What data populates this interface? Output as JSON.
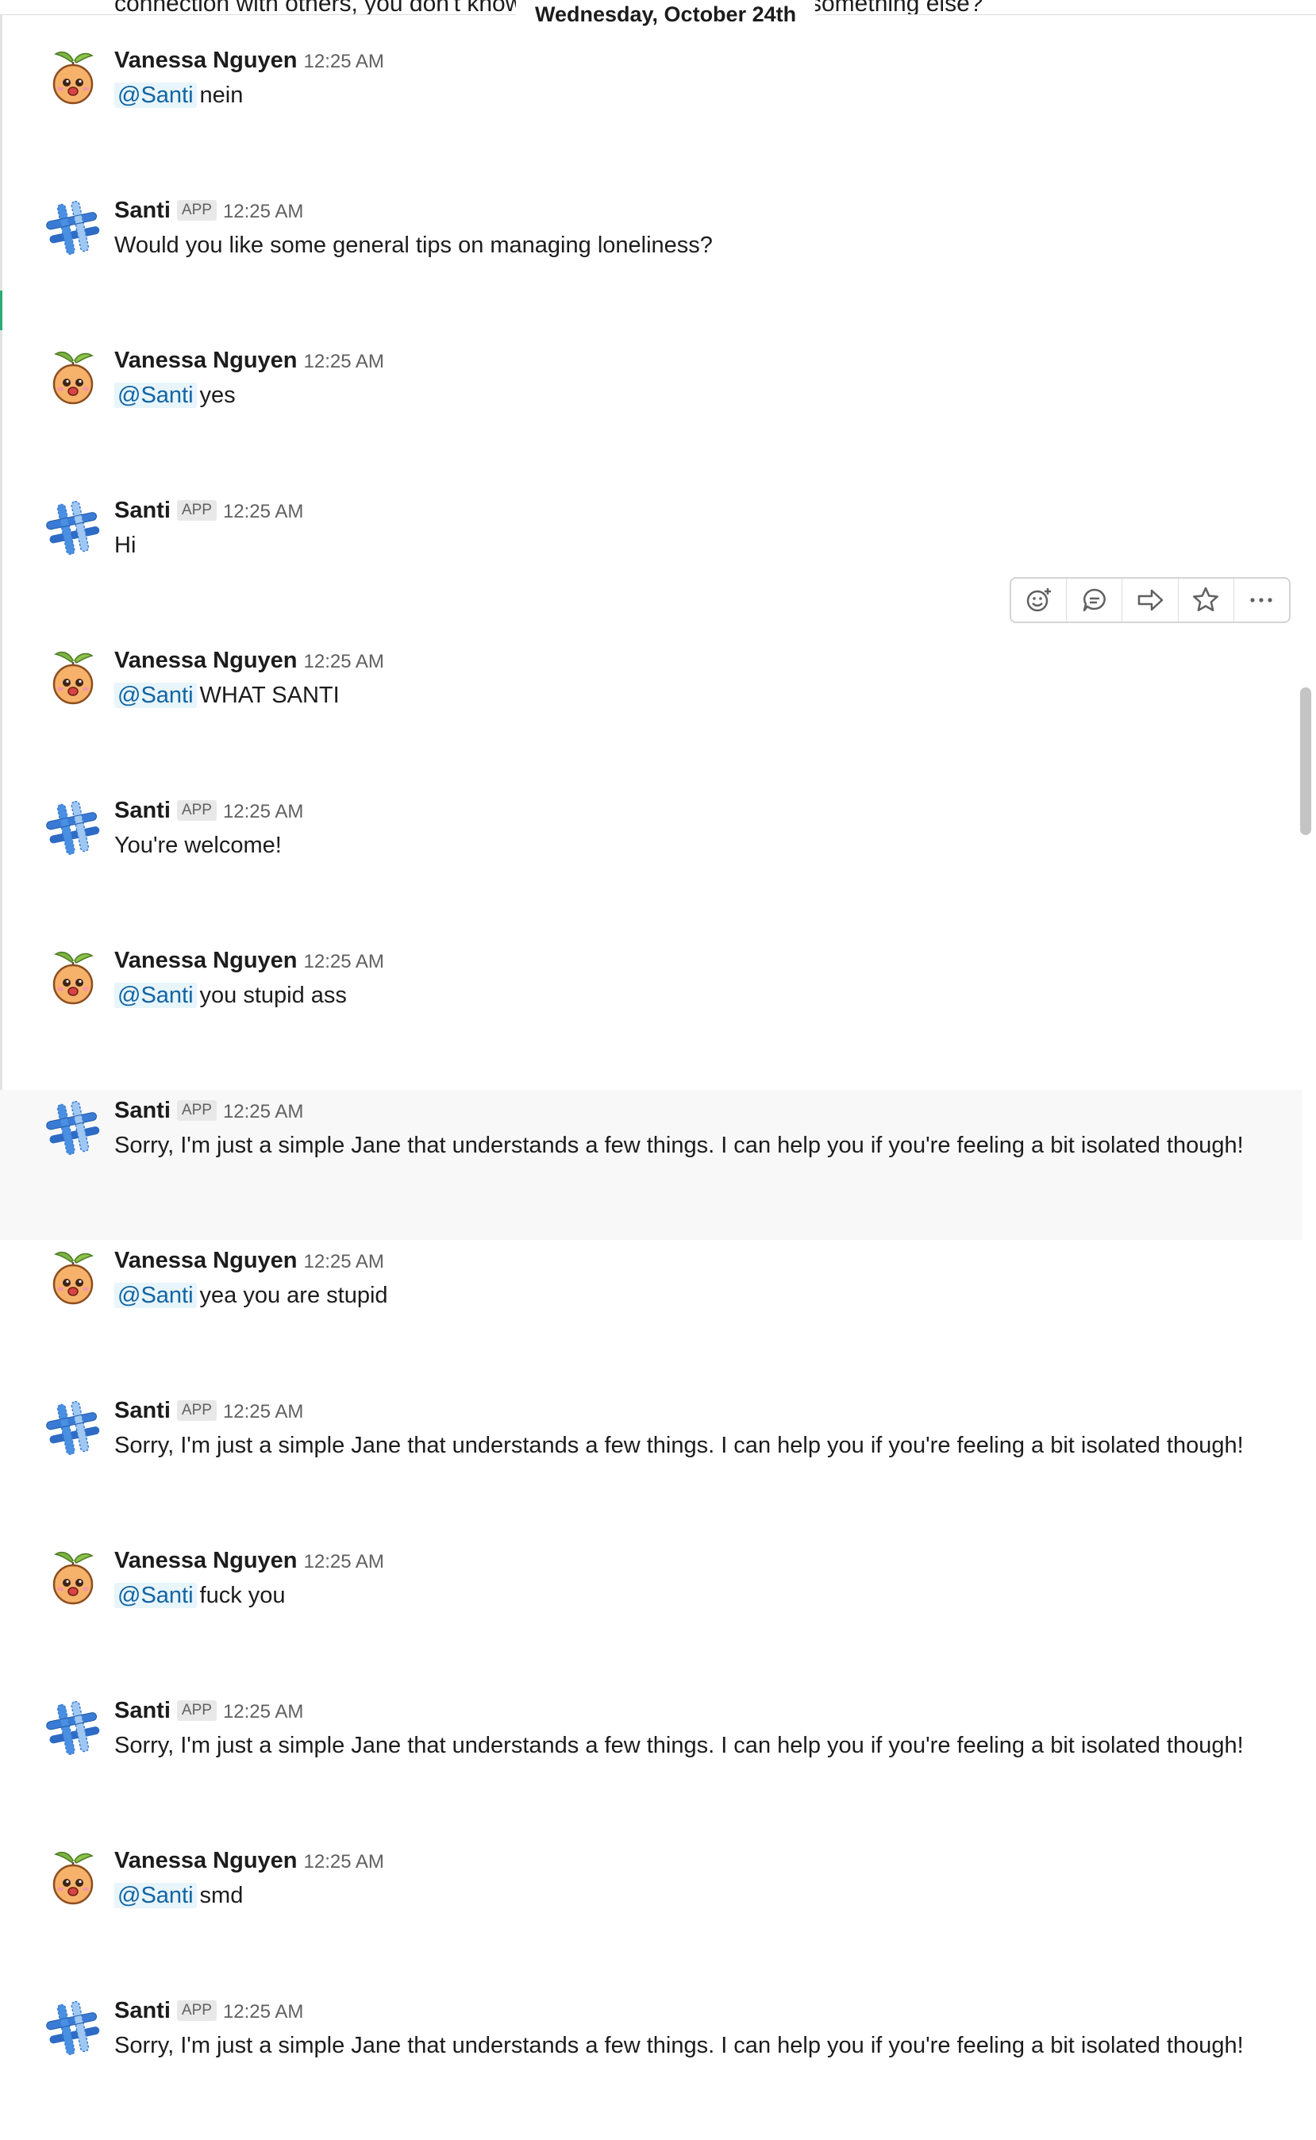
{
  "top_fragments": {
    "left": "connection with others, you don't know",
    "right": "something else?"
  },
  "day_divider": "Wednesday, October 24th",
  "users": {
    "vanessa": {
      "name": "Vanessa Nguyen"
    },
    "santi": {
      "name": "Santi",
      "badge": "APP"
    }
  },
  "messages": [
    {
      "author": "Vanessa Nguyen",
      "time": "12:25 AM",
      "mention": "@Santi",
      "text": "nein"
    },
    {
      "author": "Santi",
      "badge": "APP",
      "time": "12:25 AM",
      "text": "Would you like some general tips on managing loneliness?"
    },
    {
      "author": "Vanessa Nguyen",
      "time": "12:25 AM",
      "mention": "@Santi",
      "text": "yes"
    },
    {
      "author": "Santi",
      "badge": "APP",
      "time": "12:25 AM",
      "text": "Hi"
    },
    {
      "author": "Vanessa Nguyen",
      "time": "12:25 AM",
      "mention": "@Santi",
      "text": "WHAT SANTI"
    },
    {
      "author": "Santi",
      "badge": "APP",
      "time": "12:25 AM",
      "text": "You're welcome!"
    },
    {
      "author": "Vanessa Nguyen",
      "time": "12:25 AM",
      "mention": "@Santi",
      "text": "you stupid ass"
    },
    {
      "author": "Santi",
      "badge": "APP",
      "time": "12:25 AM",
      "text": "Sorry, I'm just a simple Jane that understands a few things. I can help you if you're feeling a bit isolated though!"
    },
    {
      "author": "Vanessa Nguyen",
      "time": "12:25 AM",
      "mention": "@Santi",
      "text": "yea you are stupid"
    },
    {
      "author": "Santi",
      "badge": "APP",
      "time": "12:25 AM",
      "text": "Sorry, I'm just a simple Jane that understands a few things. I can help you if you're feeling a bit isolated though!"
    },
    {
      "author": "Vanessa Nguyen",
      "time": "12:25 AM",
      "mention": "@Santi",
      "text": "fuck you"
    },
    {
      "author": "Santi",
      "badge": "APP",
      "time": "12:25 AM",
      "text": "Sorry, I'm just a simple Jane that understands a few things. I can help you if you're feeling a bit isolated though!"
    },
    {
      "author": "Vanessa Nguyen",
      "time": "12:25 AM",
      "mention": "@Santi",
      "text": "smd"
    },
    {
      "author": "Santi",
      "badge": "APP",
      "time": "12:25 AM",
      "text": "Sorry, I'm just a simple Jane that understands a few things. I can help you if you're feeling a bit isolated though!"
    }
  ],
  "hover_toolbar": {
    "icons": [
      "add-reaction-icon",
      "start-thread-icon",
      "share-message-icon",
      "star-icon",
      "more-actions-icon"
    ]
  },
  "colors": {
    "mention_text": "#1264a3",
    "mention_bg": "#e8f5fa",
    "hover_row_bg": "#f8f8f8",
    "santi_avatar_blue": "#3a7bd5",
    "vanessa_avatar_orange": "#f2a85b"
  }
}
